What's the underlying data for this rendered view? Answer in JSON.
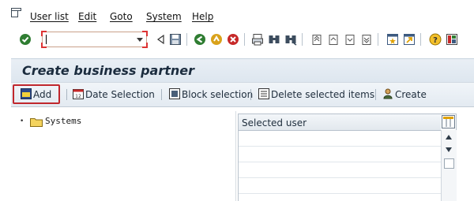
{
  "menu": {
    "items": [
      {
        "label": "User list"
      },
      {
        "label": "Edit"
      },
      {
        "label": "Goto"
      },
      {
        "label": "System"
      },
      {
        "label": "Help"
      }
    ]
  },
  "command_field": {
    "value": ""
  },
  "page_title": "Create business partner",
  "app_toolbar": {
    "add": "Add",
    "date_selection": "Date Selection",
    "block_selection": "Block selection",
    "delete_selected": "Delete selected items",
    "create": "Create"
  },
  "tree": {
    "items": [
      {
        "label": "Systems"
      }
    ]
  },
  "table": {
    "header": "Selected user",
    "rows": []
  },
  "colors": {
    "accent": "#c0272d",
    "title_bg": "#e9eff5",
    "toolbar_bg": "#eef2f6"
  }
}
